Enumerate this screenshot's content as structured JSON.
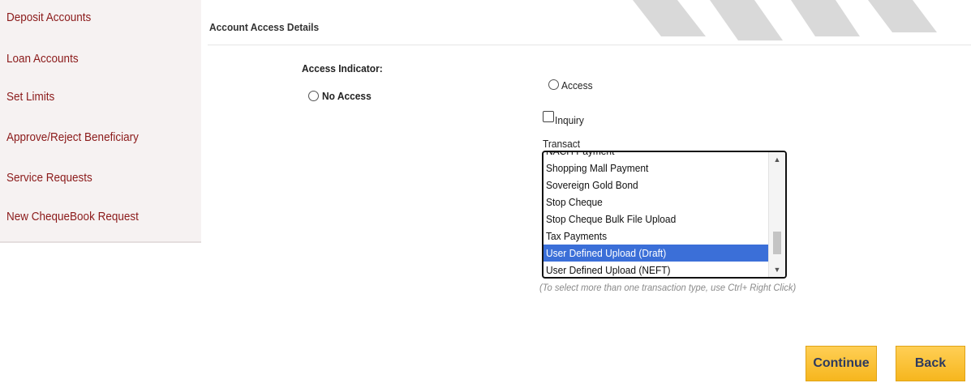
{
  "sidebar": {
    "items": [
      {
        "label": "Deposit Accounts"
      },
      {
        "label": "Loan Accounts"
      },
      {
        "label": "Set Limits"
      },
      {
        "label": "Approve/Reject Beneficiary"
      },
      {
        "label": "Service Requests"
      },
      {
        "label": "New ChequeBook Request"
      }
    ]
  },
  "section": {
    "title": "Account Access Details"
  },
  "access": {
    "indicator_label": "Access Indicator:",
    "no_access_label": "No Access",
    "access_label": "Access",
    "inquiry_label": "Inquiry",
    "transact_label": "Transact"
  },
  "transactions": {
    "partial_top": "NACH Payment",
    "items": [
      "Shopping Mall Payment",
      "Sovereign Gold Bond",
      "Stop Cheque",
      "Stop Cheque Bulk File Upload",
      "Tax Payments",
      "User Defined Upload (Draft)",
      "User Defined Upload (NEFT)"
    ],
    "selected": "User Defined Upload (Draft)",
    "hint": "(To select more than one transaction type, use Ctrl+ Right Click)"
  },
  "buttons": {
    "continue": "Continue",
    "back": "Back"
  },
  "colors": {
    "sidebar_link": "#8b1a1a",
    "button": "#f6b61e",
    "selection": "#3b6fd8"
  }
}
